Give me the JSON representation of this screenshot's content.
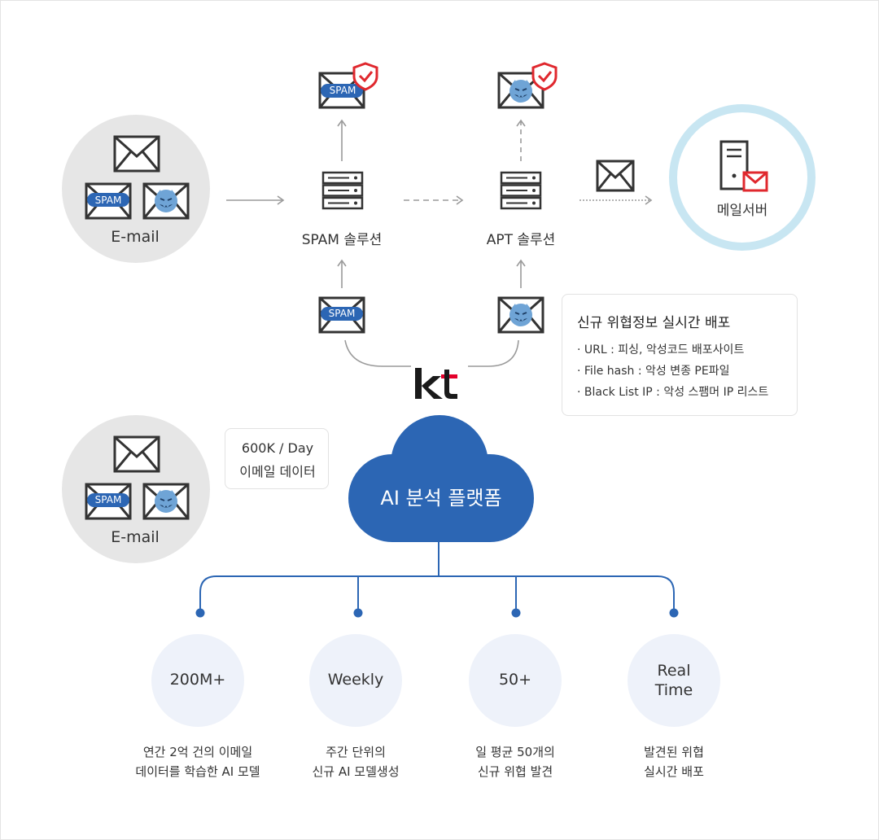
{
  "diagram": {
    "email_group_top": {
      "label": "E-mail"
    },
    "email_group_bottom": {
      "label": "E-mail"
    },
    "spam_badge": "SPAM",
    "spam_solution": {
      "label": "SPAM 솔루션"
    },
    "apt_solution": {
      "label": "APT 솔루션"
    },
    "mail_server": {
      "label": "메일서버"
    },
    "info_box": {
      "title": "신규 위협정보 실시간 배포",
      "items": [
        "·  URL : 피싱, 악성코드 배포사이트",
        "·  File hash : 악성 변종 PE파일",
        "·  Black List IP : 악성 스팸머 IP 리스트"
      ]
    },
    "brand_logo": "kt",
    "stat_box": {
      "line1": "600K / Day",
      "line2": "이메일 데이터"
    },
    "platform": {
      "label": "AI 분석 플랫폼"
    },
    "metrics": [
      {
        "value_lines": [
          "200M+"
        ],
        "desc_lines": [
          "연간 2억 건의 이메일",
          "데이터를 학습한 AI 모델"
        ]
      },
      {
        "value_lines": [
          "Weekly"
        ],
        "desc_lines": [
          "주간 단위의",
          "신규 AI 모델생성"
        ]
      },
      {
        "value_lines": [
          "50+"
        ],
        "desc_lines": [
          "일 평균 50개의",
          "신규 위협 발견"
        ]
      },
      {
        "value_lines": [
          "Real",
          "Time"
        ],
        "desc_lines": [
          "발견된 위협",
          "실시간 배포"
        ]
      }
    ],
    "colors": {
      "brand_blue": "#2c66b4",
      "spam_blue": "#2c66b4",
      "shield_red": "#e0282e",
      "kt_red": "#e4002b",
      "ring_blue": "#c8e6f2",
      "gray_circle": "#e6e6e6"
    },
    "icons": [
      "envelope-icon",
      "spam-envelope-icon",
      "virus-envelope-icon",
      "shield-check-icon",
      "server-rack-icon",
      "server-tower-icon",
      "cloud-icon"
    ]
  }
}
